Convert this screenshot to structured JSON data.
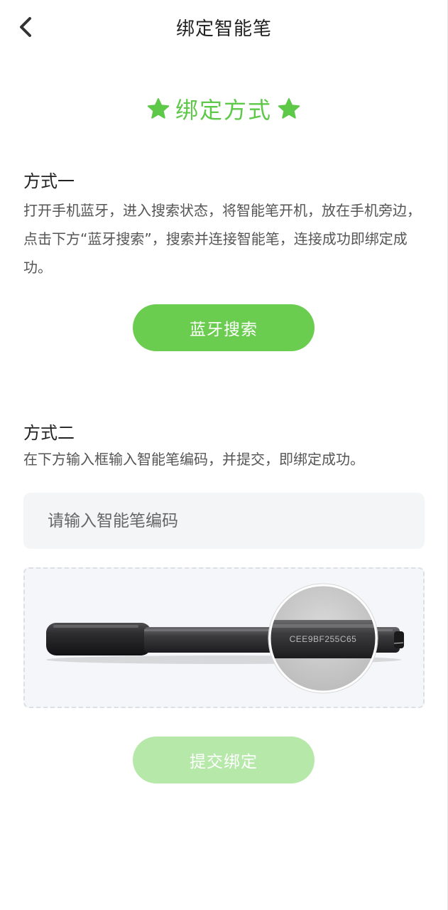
{
  "header": {
    "title": "绑定智能笔",
    "back_icon": "chevron-left-icon"
  },
  "heading": {
    "text": "绑定方式",
    "icon": "star-icon",
    "accent_color": "#5ec848"
  },
  "method_one": {
    "title": "方式一",
    "description": "打开手机蓝牙，进入搜索状态，将智能笔开机，放在手机旁边，点击下方“蓝牙搜索”，搜索并连接智能笔，连接成功即绑定成功。",
    "button_label": "蓝牙搜索",
    "button_color": "#6bcd4f"
  },
  "method_two": {
    "title": "方式二",
    "description": "在下方输入框输入智能笔编码，并提交，即绑定成功。",
    "input_placeholder": "请输入智能笔编码",
    "input_value": "",
    "pen_serial": "CEE9BF255C65",
    "submit_label": "提交绑定",
    "submit_color": "#b6e8a9"
  }
}
